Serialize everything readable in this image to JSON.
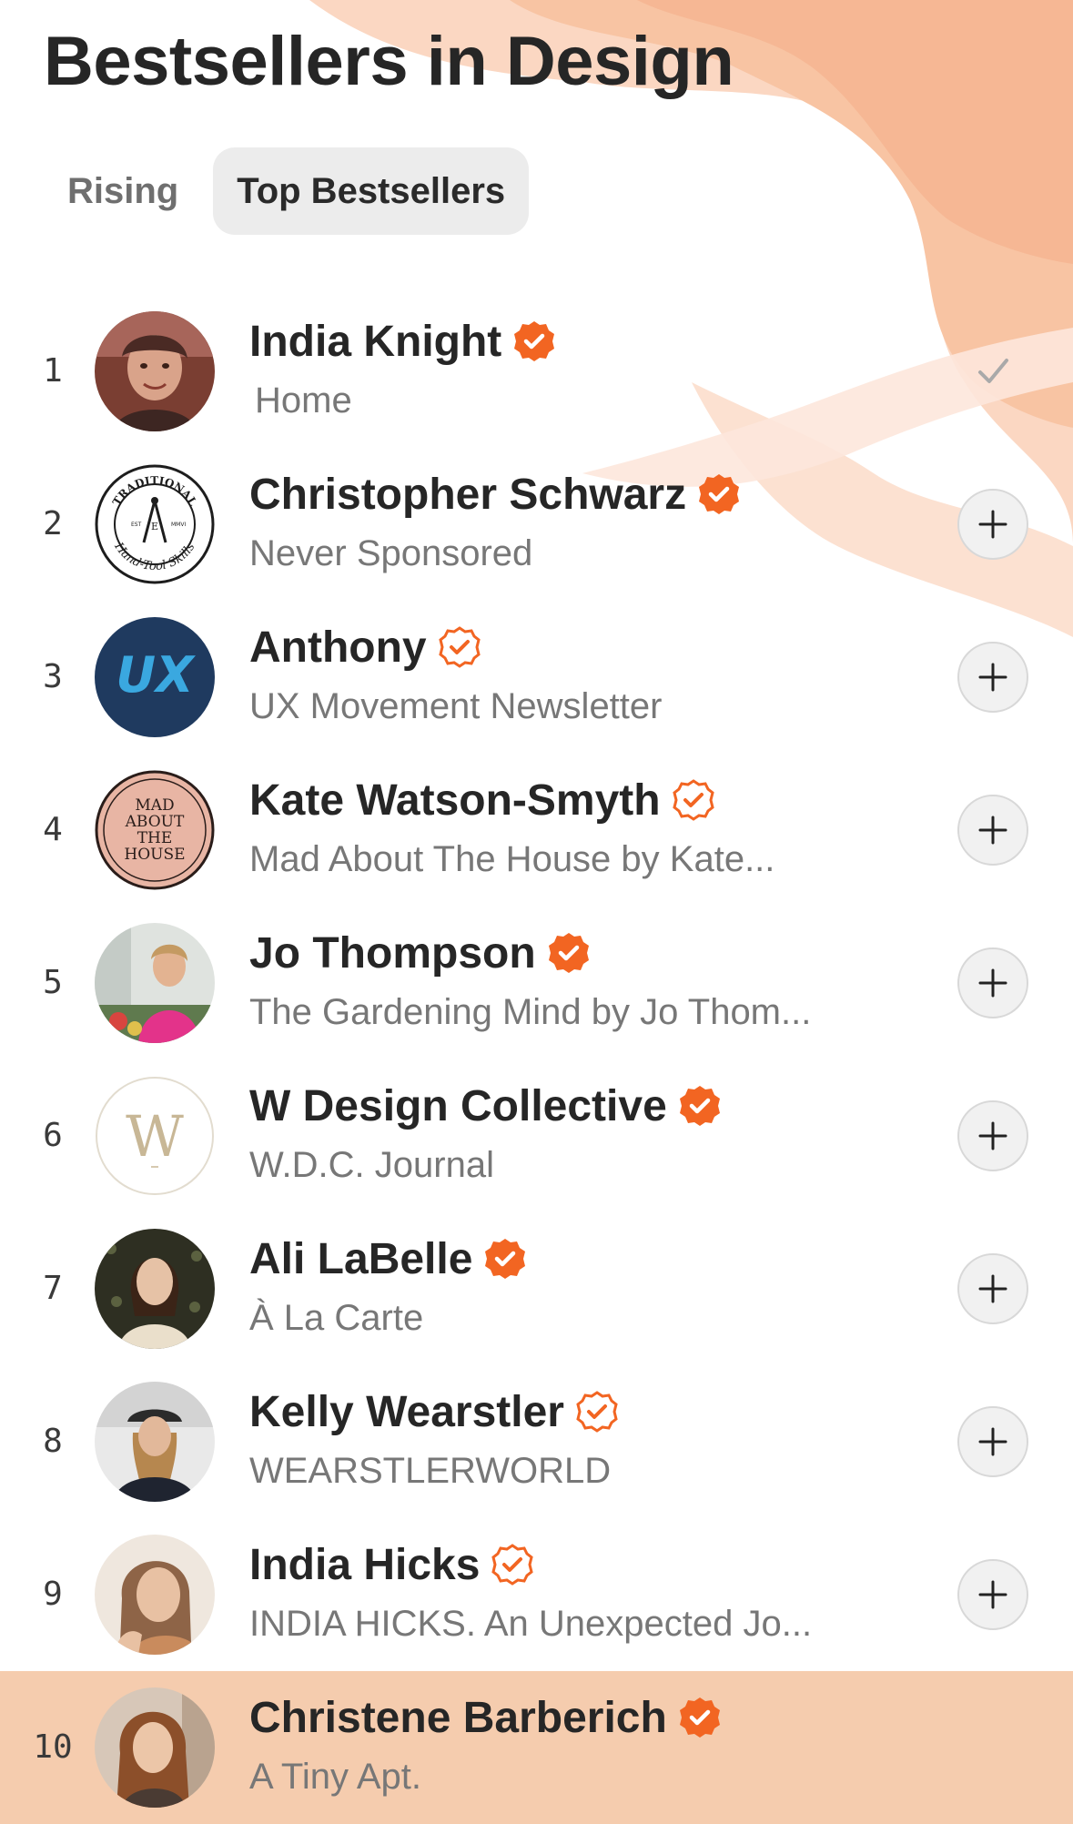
{
  "header": {
    "title": "Bestsellers in Design"
  },
  "tabs": [
    {
      "label": "Rising",
      "active": false
    },
    {
      "label": "Top Bestsellers",
      "active": true
    }
  ],
  "colors": {
    "accent": "#f26522",
    "highlight_row": "#f5ccae",
    "swirl": "#f9c7a8",
    "text_primary": "#262626",
    "text_secondary": "#777777"
  },
  "rows": [
    {
      "rank": "1",
      "name": "India Knight",
      "subtitle": "Home",
      "badge": "verified-filled-icon",
      "action": "checkmark-icon",
      "avatar": "portrait-woman"
    },
    {
      "rank": "2",
      "name": "Christopher Schwarz",
      "subtitle": "Never Sponsored",
      "badge": "verified-filled-icon",
      "action": "plus-icon",
      "avatar": "traditional-hand-tool-skills-seal",
      "avatar_text": {
        "top": "TRADITIONAL",
        "bottom": "Hand-Tool Skills",
        "left": "EST",
        "right": "MMVI",
        "center": "E"
      }
    },
    {
      "rank": "3",
      "name": "Anthony",
      "subtitle": "UX Movement Newsletter",
      "badge": "verified-outline-icon",
      "action": "plus-icon",
      "avatar": "ux-logo",
      "avatar_text": {
        "label": "UX"
      }
    },
    {
      "rank": "4",
      "name": "Kate Watson-Smyth",
      "subtitle": "Mad About The House by Kate...",
      "badge": "verified-outline-icon",
      "action": "plus-icon",
      "avatar": "mad-about-the-house-logo",
      "avatar_text": {
        "line1": "MAD",
        "line2": "ABOUT",
        "line3": "THE",
        "line4": "HOUSE"
      }
    },
    {
      "rank": "5",
      "name": "Jo Thompson",
      "subtitle": "The Gardening Mind by Jo Thom...",
      "badge": "verified-filled-icon",
      "action": "plus-icon",
      "avatar": "portrait-woman-garden"
    },
    {
      "rank": "6",
      "name": "W Design Collective",
      "subtitle": "W.D.C. Journal",
      "badge": "verified-filled-icon",
      "action": "plus-icon",
      "avatar": "w-monogram-logo",
      "avatar_text": {
        "label": "W"
      }
    },
    {
      "rank": "7",
      "name": "Ali LaBelle",
      "subtitle": "À La Carte",
      "badge": "verified-filled-icon",
      "action": "plus-icon",
      "avatar": "portrait-woman-dark"
    },
    {
      "rank": "8",
      "name": "Kelly Wearstler",
      "subtitle": "WEARSTLERWORLD",
      "badge": "verified-outline-icon",
      "action": "plus-icon",
      "avatar": "portrait-woman-cap"
    },
    {
      "rank": "9",
      "name": "India Hicks",
      "subtitle": "INDIA HICKS. An Unexpected Jo...",
      "badge": "verified-outline-icon",
      "action": "plus-icon",
      "avatar": "portrait-woman-light"
    },
    {
      "rank": "10",
      "name": "Christene Barberich",
      "subtitle": "A Tiny Apt.",
      "badge": "verified-filled-icon",
      "action": "none",
      "avatar": "portrait-woman-auburn",
      "highlight": true
    }
  ]
}
